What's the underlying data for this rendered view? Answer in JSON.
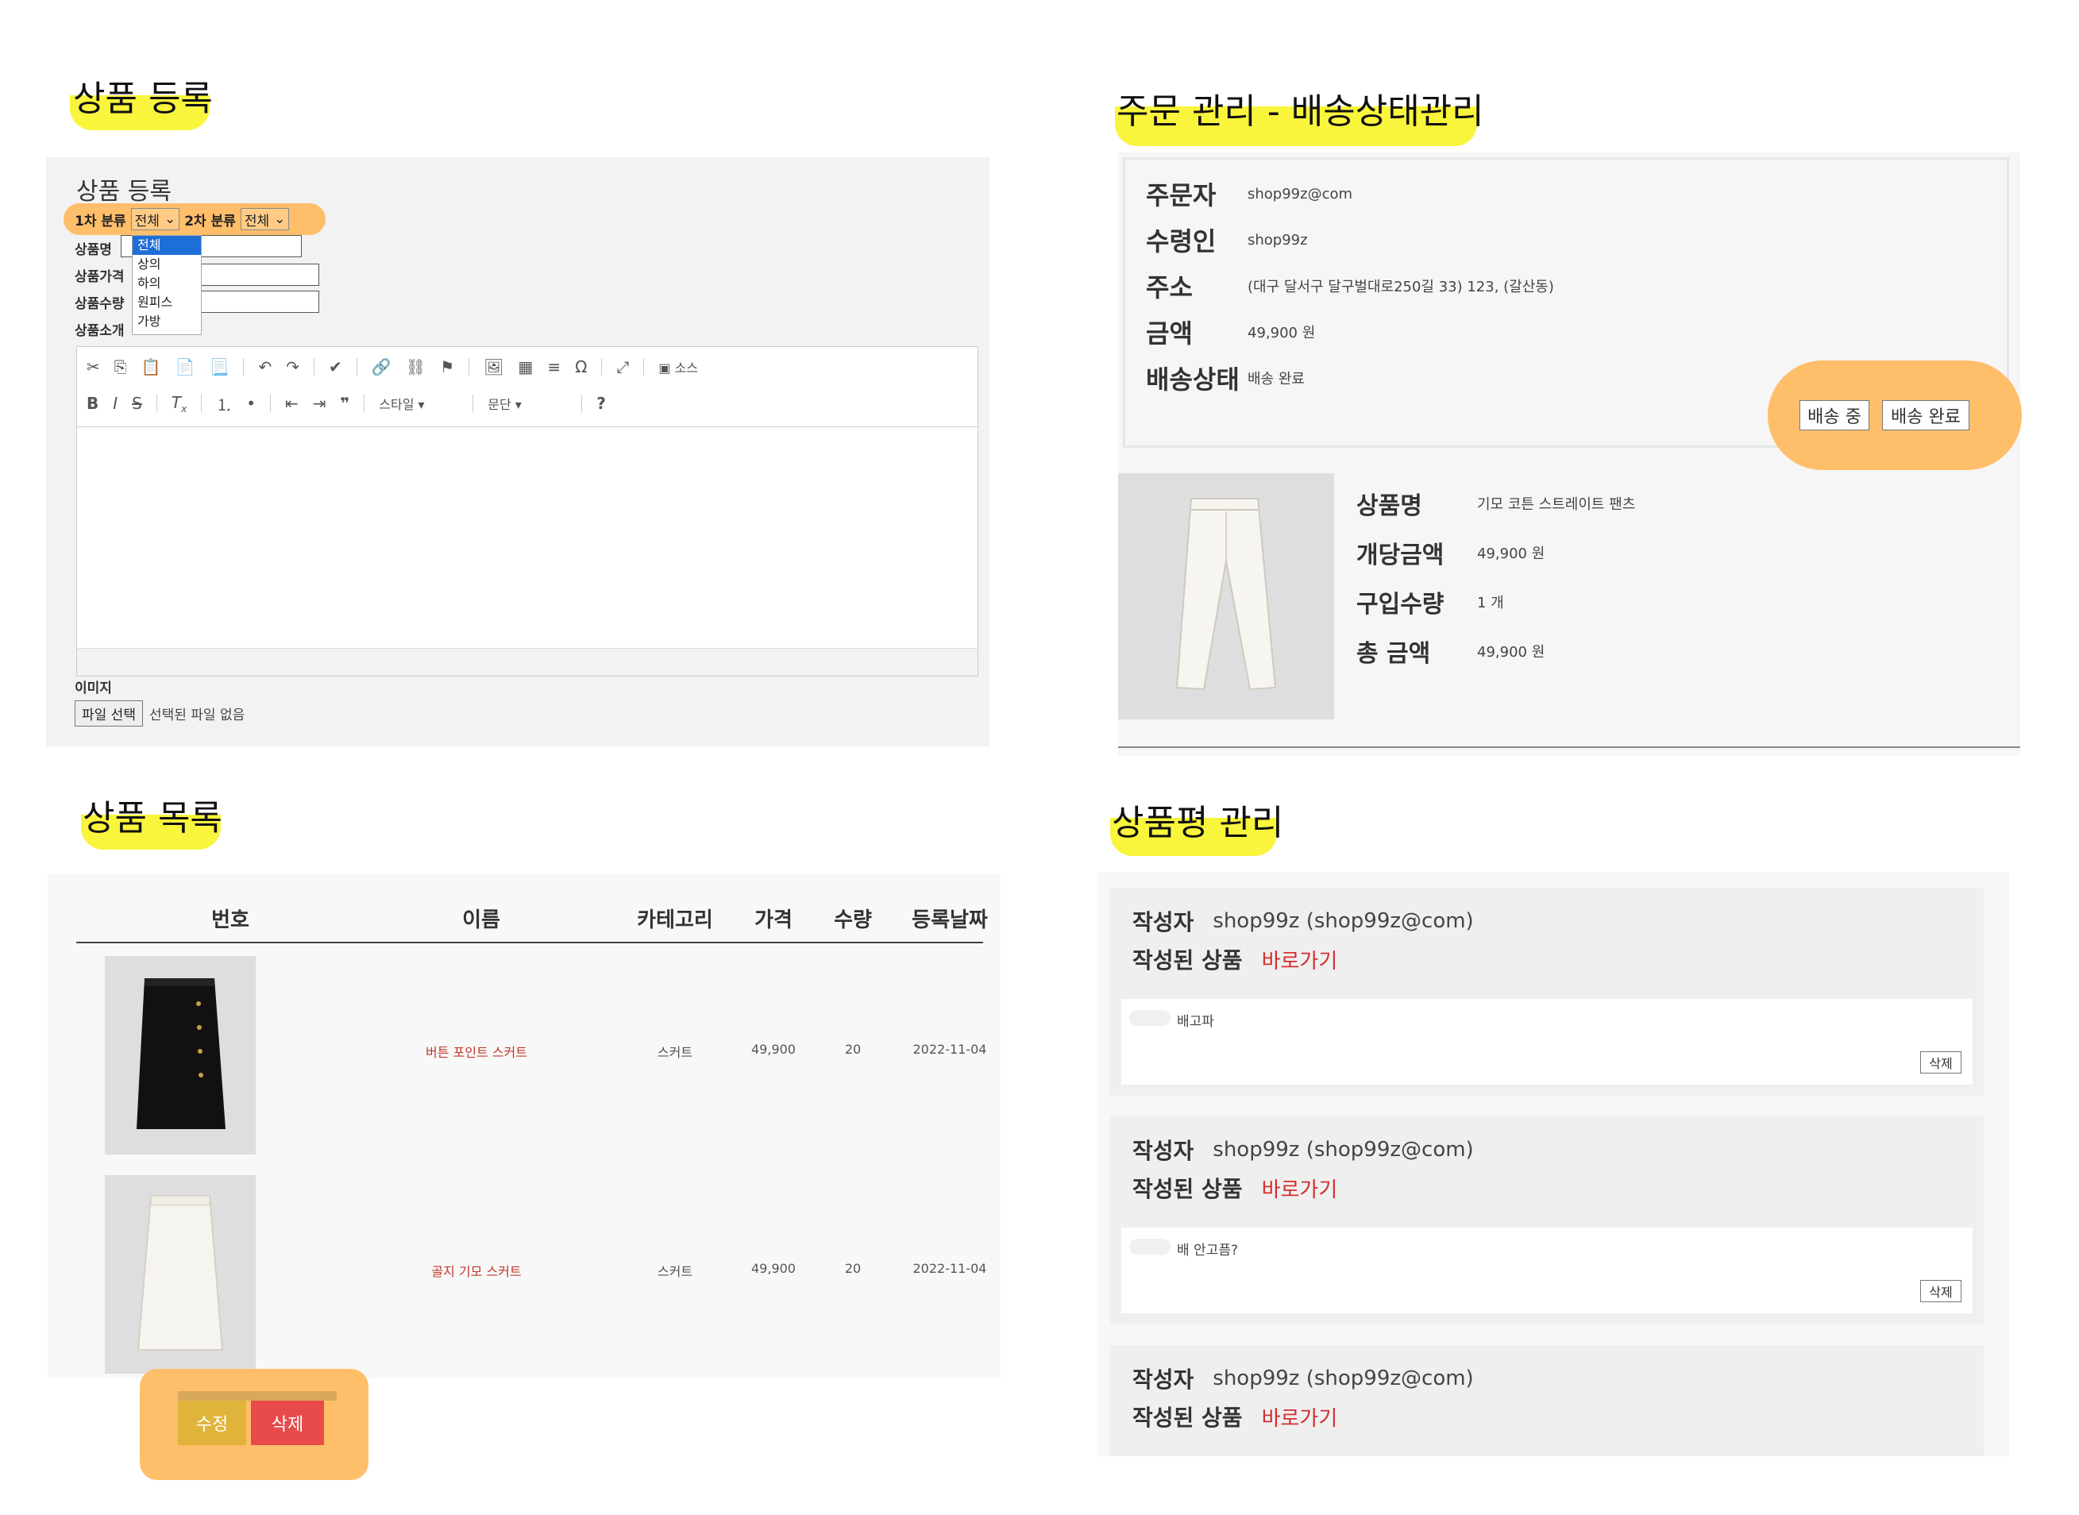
{
  "sections": {
    "register": "상품 등록",
    "order": "주문 관리 - 배송상태관리",
    "list": "상품 목록",
    "review": "상품평 관리"
  },
  "register_form": {
    "title": "상품 등록",
    "cat1_label": "1차 분류",
    "cat1_value": "전체",
    "cat2_label": "2차 분류",
    "cat2_value": "전체",
    "dropdown_options": [
      "전체",
      "상의",
      "하의",
      "원피스",
      "가방"
    ],
    "field_name": "상품명",
    "field_price": "상품가격",
    "field_qty": "상품수량",
    "field_desc": "상품소개",
    "toolbar_source": "소스",
    "toolbar_style": "스타일",
    "toolbar_format": "문단",
    "toolbar_help": "?",
    "image_label": "이미지",
    "file_button": "파일 선택",
    "file_status": "선택된 파일 없음"
  },
  "order": {
    "orderer_label": "주문자",
    "orderer_value": "shop99z@com",
    "receiver_label": "수령인",
    "receiver_value": "shop99z",
    "address_label": "주소",
    "address_value": "(대구 달서구 달구벌대로250길 33) 123, (갈산동)",
    "amount_label": "금액",
    "amount_value": "49,900 원",
    "status_label": "배송상태",
    "status_value": "배송 완료",
    "btn_shipping": "배송 중",
    "btn_delivered": "배송 완료",
    "product_name_label": "상품명",
    "product_name_value": "기모 코튼 스트레이트 팬츠",
    "unit_price_label": "개당금액",
    "unit_price_value": "49,900 원",
    "qty_label": "구입수량",
    "qty_value": "1 개",
    "total_label": "총 금액",
    "total_value": "49,900 원"
  },
  "product_list": {
    "headers": [
      "번호",
      "이름",
      "카테고리",
      "가격",
      "수량",
      "등록날짜"
    ],
    "rows": [
      {
        "name": "버튼 포인트 스커트",
        "category": "스커트",
        "price": "49,900",
        "qty": "20",
        "date": "2022-11-04"
      },
      {
        "name": "골지 기모 스커트",
        "category": "스커트",
        "price": "49,900",
        "qty": "20",
        "date": "2022-11-04"
      }
    ],
    "btn_edit": "수정",
    "btn_delete": "삭제"
  },
  "reviews": {
    "author_label": "작성자",
    "product_label": "작성된 상품",
    "link_text": "바로가기",
    "delete_label": "삭제",
    "items": [
      {
        "author": "shop99z (shop99z@com)",
        "content": "배고파"
      },
      {
        "author": "shop99z (shop99z@com)",
        "content": "배 안고픔?"
      },
      {
        "author": "shop99z (shop99z@com)"
      }
    ]
  },
  "colors": {
    "highlight_yellow": "#f8f53c",
    "highlight_orange": "#ffbe6a",
    "edit_button": "#e0b43a",
    "delete_button": "#e94b4b",
    "link_red": "#d32f2f"
  }
}
